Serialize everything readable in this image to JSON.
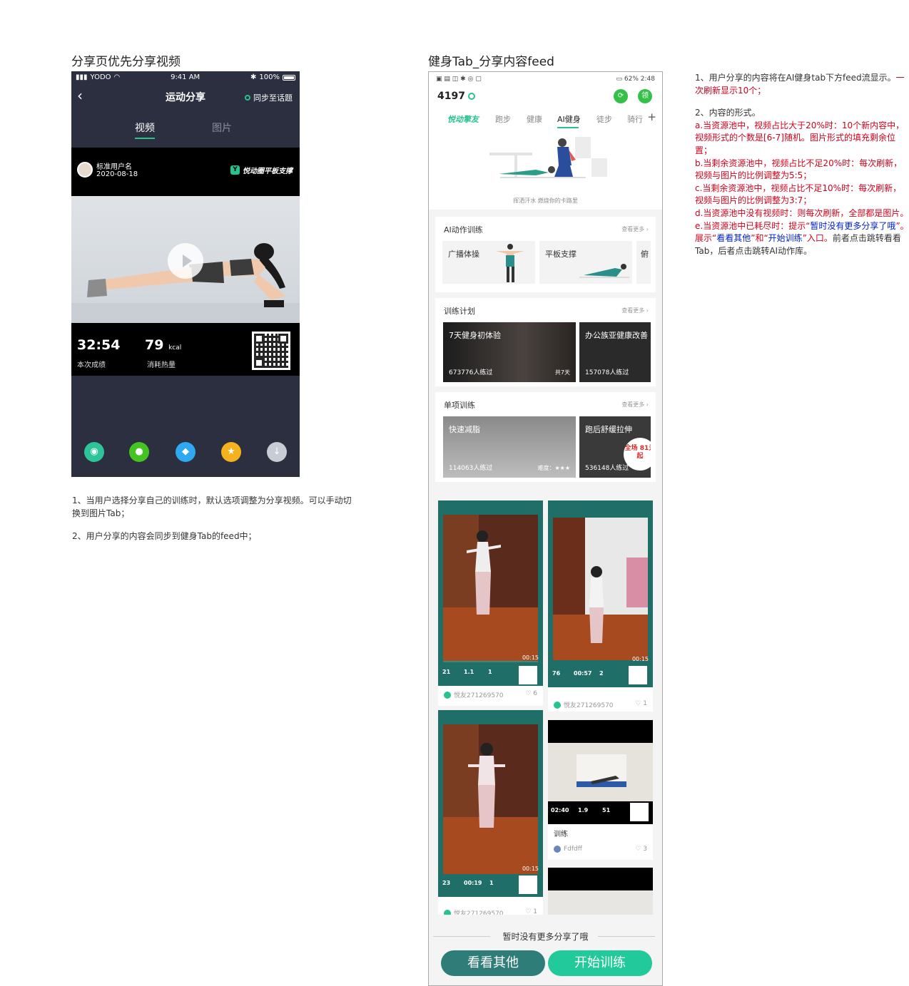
{
  "left_section_title": "分享页优先分享视频",
  "right_section_title": "健身Tab_分享内容feed",
  "share_page": {
    "status": {
      "carrier": "YODO",
      "time": "9:41 AM",
      "battery": "100%"
    },
    "nav": {
      "back_icon": "chevron-left-icon",
      "title": "运动分享",
      "sync_label": "同步至话题"
    },
    "tabs": [
      {
        "label": "视频"
      },
      {
        "label": "图片"
      }
    ],
    "user": {
      "name": "标准用户名",
      "date": "2020-08-18",
      "badge": "悦动圈平板支撑"
    },
    "stats": [
      {
        "value": "32:54",
        "unit": "",
        "label": "本次成绩"
      },
      {
        "value": "79",
        "unit": "kcal",
        "label": "消耗热量"
      }
    ],
    "share_icons": [
      {
        "name": "moments-icon",
        "color": "#2dc49a"
      },
      {
        "name": "wechat-icon",
        "color": "#44c322"
      },
      {
        "name": "qq-icon",
        "color": "#2ea9f0"
      },
      {
        "name": "qzone-icon",
        "color": "#f5b21e"
      },
      {
        "name": "download-icon",
        "color": "#c8ccd4"
      }
    ]
  },
  "left_notes": [
    "1、当用户选择分享自己的训练时，默认选项调整为分享视频。可以手动切换到图片Tab；",
    "2、用户分享的内容会同步到健身Tab的feed中；"
  ],
  "feed_page": {
    "status": {
      "time": "2:48",
      "battery": "62%"
    },
    "score": "4197",
    "tabs": [
      "悦动擎友",
      "跑步",
      "健康",
      "AI健身",
      "徒步",
      "骑行"
    ],
    "banner_caption": "挥洒汗水 燃烧你的卡路里",
    "ai_training": {
      "title": "AI动作训练",
      "more": "查看更多",
      "items": [
        "广播体操",
        "平板支撑",
        "俯"
      ]
    },
    "plans": {
      "title": "训练计划",
      "more": "查看更多",
      "items": [
        {
          "name": "7天健身初体验",
          "count": "673776人练过",
          "days": "共7天"
        },
        {
          "name": "办公族亚健康改善",
          "count": "157078人练过"
        }
      ]
    },
    "single": {
      "title": "单项训练",
      "more": "查看更多",
      "items": [
        {
          "name": "快速减脂",
          "count": "114063人练过",
          "difficulty": "难度：★★★"
        },
        {
          "name": "跑后舒缓拉伸",
          "count": "536148人练过",
          "promo": "全场 81元起"
        }
      ]
    },
    "feed": [
      {
        "user": "悦友271269570",
        "likes": "6",
        "duration": "00:15",
        "stats": [
          "21",
          "1.1",
          "1"
        ]
      },
      {
        "user": "悦友271269570",
        "likes": "1",
        "duration": "00:15",
        "stats": [
          "76",
          "00:57",
          "2"
        ]
      },
      {
        "user": "悦友271269570",
        "likes": "1",
        "duration": "00:15",
        "stats": [
          "23",
          "00:19",
          "1"
        ]
      },
      {
        "user": "Fdfdff",
        "likes": "3",
        "caption": "训练",
        "stats": [
          "02:40",
          "1.9",
          "51"
        ]
      }
    ],
    "no_more": "暂时没有更多分享了哦",
    "btn_look": "看看其他",
    "btn_train": "开始训练"
  },
  "right_notes": {
    "p1a": "1、用户分享的内容将在AI健身tab下方feed流显示。",
    "p1b": "一次刷新显示10个；",
    "p2": "2、内容的形式。",
    "a": "a.当资源池中，视频占比大于20%时：10个新内容中，视频形式的个数是[6-7]随机。图片形式的填充剩余位置；",
    "b": "b.当剩余资源池中，视频占比不足20%时：每次刷新，视频与图片的比例调整为5:5；",
    "c": "c.当剩余资源池中，视频占比不足10%时：每次刷新，视频与图片的比例调整为3:7；",
    "d": "d.当资源池中没有视频时：则每次刷新，全部都是图片。",
    "e1": "e.当资源池中已耗尽时：提示“",
    "e2": "暂时没有更多分享了哦",
    "e3": "”。展示“",
    "e4": "看看其他",
    "e5": "”和“",
    "e6": "开始训练",
    "e7": "”入口。",
    "e8": "前者点击跳转看看Tab，后者点击跳转AI动作库。"
  }
}
